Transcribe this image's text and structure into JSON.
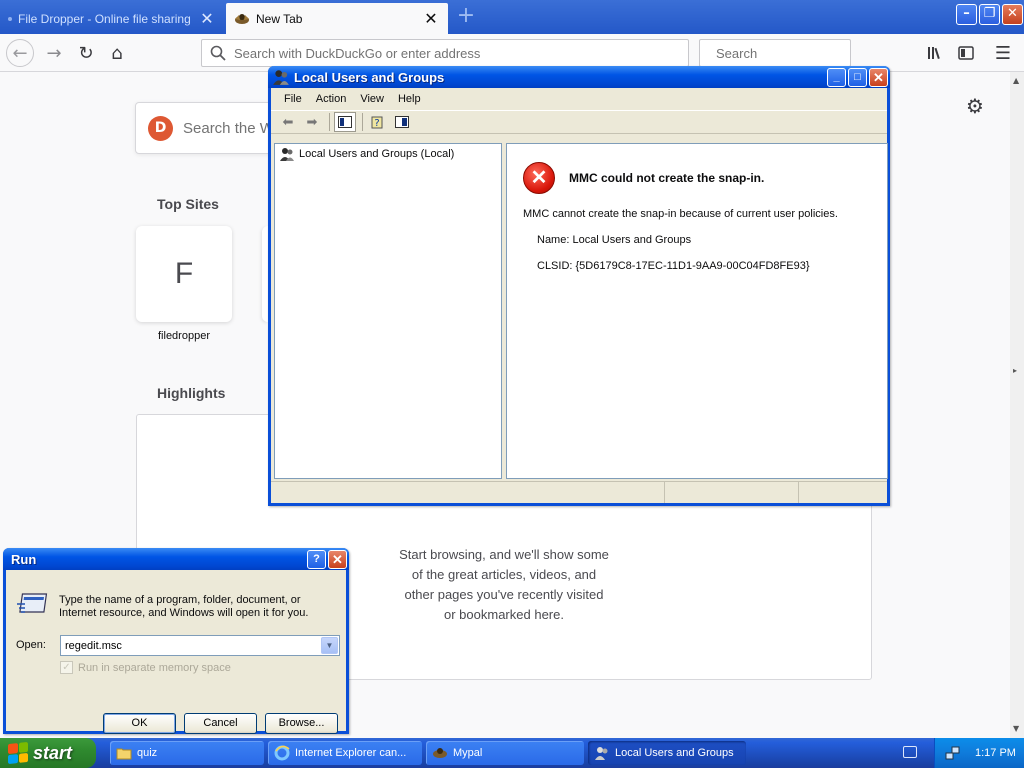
{
  "browser": {
    "tabs": [
      {
        "label": "File Dropper - Online file sharing",
        "active": false
      },
      {
        "label": "New Tab",
        "active": true
      }
    ],
    "urlbar_placeholder": "Search with DuckDuckGo or enter address",
    "searchbar_placeholder": "Search",
    "content": {
      "search_placeholder": "Search the Web",
      "top_sites_title": "Top Sites",
      "top_site": {
        "letter": "F",
        "label": "filedropper"
      },
      "highlights_title": "Highlights",
      "highlights_message": "Start browsing, and we'll show some of the great articles, videos, and other pages you've recently visited or bookmarked here."
    }
  },
  "mmc": {
    "title": "Local Users and Groups",
    "menu": [
      "File",
      "Action",
      "View",
      "Help"
    ],
    "tree_root": "Local Users and Groups (Local)",
    "error_title": "MMC could not create the snap-in.",
    "error_body": "MMC cannot create the snap-in because of current user policies.",
    "error_name": "Name: Local Users and Groups",
    "error_clsid": "CLSID: {5D6179C8-17EC-11D1-9AA9-00C04FD8FE93}"
  },
  "run": {
    "title": "Run",
    "description": "Type the name of a program, folder, document, or Internet resource, and Windows will open it for you.",
    "open_label": "Open:",
    "open_value": "regedit.msc",
    "separate_memory_label": "Run in separate memory space",
    "separate_memory_checked": true,
    "ok_label": "OK",
    "cancel_label": "Cancel",
    "browse_label": "Browse..."
  },
  "taskbar": {
    "start_label": "start",
    "items": [
      {
        "label": "quiz",
        "active": false
      },
      {
        "label": "Internet Explorer can...",
        "active": false
      },
      {
        "label": "Mypal",
        "active": false
      },
      {
        "label": "Local Users and Groups",
        "active": true
      }
    ],
    "clock": "1:17 PM"
  },
  "colors": {
    "xp_title_blue": "#0055e5",
    "xp_start_green": "#2f8a2f",
    "ddg_orange": "#de5833",
    "error_red": "#d8160a"
  }
}
